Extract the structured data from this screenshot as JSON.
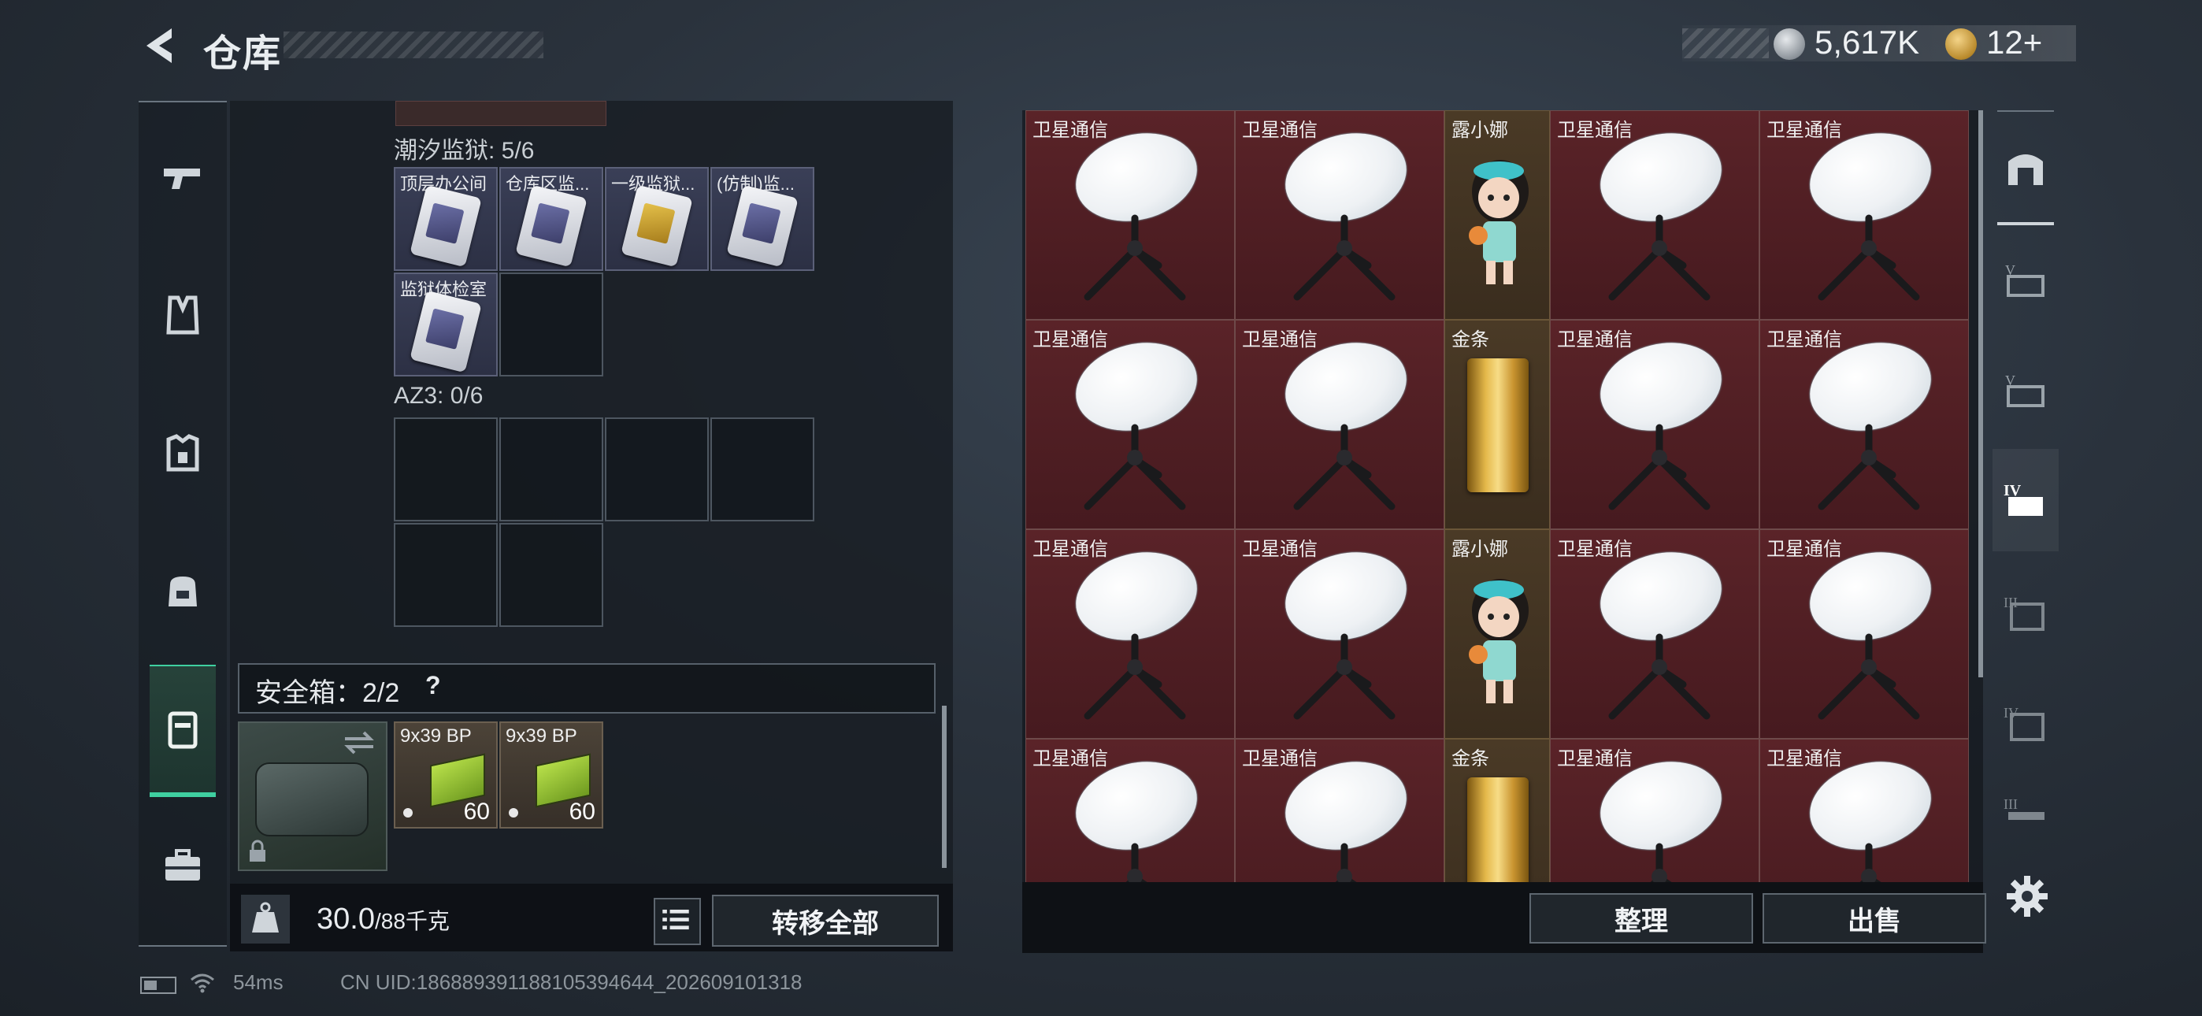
{
  "header": {
    "title": "仓库",
    "currency": [
      {
        "icon": "silver-coin-icon",
        "value": "5,617K"
      },
      {
        "icon": "gold-coin-icon",
        "value": "12+"
      }
    ]
  },
  "categories": [
    {
      "icon": "pistol-icon"
    },
    {
      "icon": "vest-icon"
    },
    {
      "icon": "armor-icon"
    },
    {
      "icon": "backpack-icon"
    },
    {
      "icon": "safebox-icon",
      "active": true
    },
    {
      "icon": "toolbox-icon"
    }
  ],
  "left": {
    "section1": {
      "label": "潮汐监狱: 5/6",
      "items": [
        {
          "label": "顶层办公间"
        },
        {
          "label": "仓库区监..."
        },
        {
          "label": "一级监狱..."
        },
        {
          "label": "(仿制)监..."
        },
        {
          "label": "监狱体检室"
        }
      ]
    },
    "section2": {
      "label": "AZ3: 0/6"
    },
    "safebox": {
      "label": "安全箱：2/2",
      "help": "?"
    },
    "ammo": [
      {
        "name": "9x39 BP",
        "count": "60"
      },
      {
        "name": "9x39 BP",
        "count": "60"
      }
    ],
    "weight": {
      "current": "30.0",
      "max": "/88千克"
    },
    "transfer_button": "转移全部"
  },
  "grid": {
    "rows": [
      [
        "卫星通信",
        "卫星通信",
        "露小娜",
        "卫星通信",
        "卫星通信"
      ],
      [
        "卫星通信",
        "卫星通信",
        "金条",
        "卫星通信",
        "卫星通信"
      ],
      [
        "卫星通信",
        "卫星通信",
        "露小娜",
        "卫星通信",
        "卫星通信"
      ],
      [
        "卫星通信",
        "卫星通信",
        "金条",
        "卫星通信",
        "卫星通信"
      ]
    ],
    "sort_button": "整理",
    "sell_button": "出售"
  },
  "filters": [
    {
      "icon": "home-tab-icon"
    },
    {
      "icon": "tier-v-tab-icon"
    },
    {
      "icon": "tier-v-alt-tab-icon"
    },
    {
      "icon": "tier-iv-tab-icon",
      "active": true
    },
    {
      "icon": "tier-iii-tab-icon"
    },
    {
      "icon": "tier-iv-alt-tab-icon"
    },
    {
      "icon": "tier-iii-alt-tab-icon"
    }
  ],
  "status": {
    "ping": "54ms",
    "uid": "CN UID:1868893911881053946​44_202609101318"
  }
}
